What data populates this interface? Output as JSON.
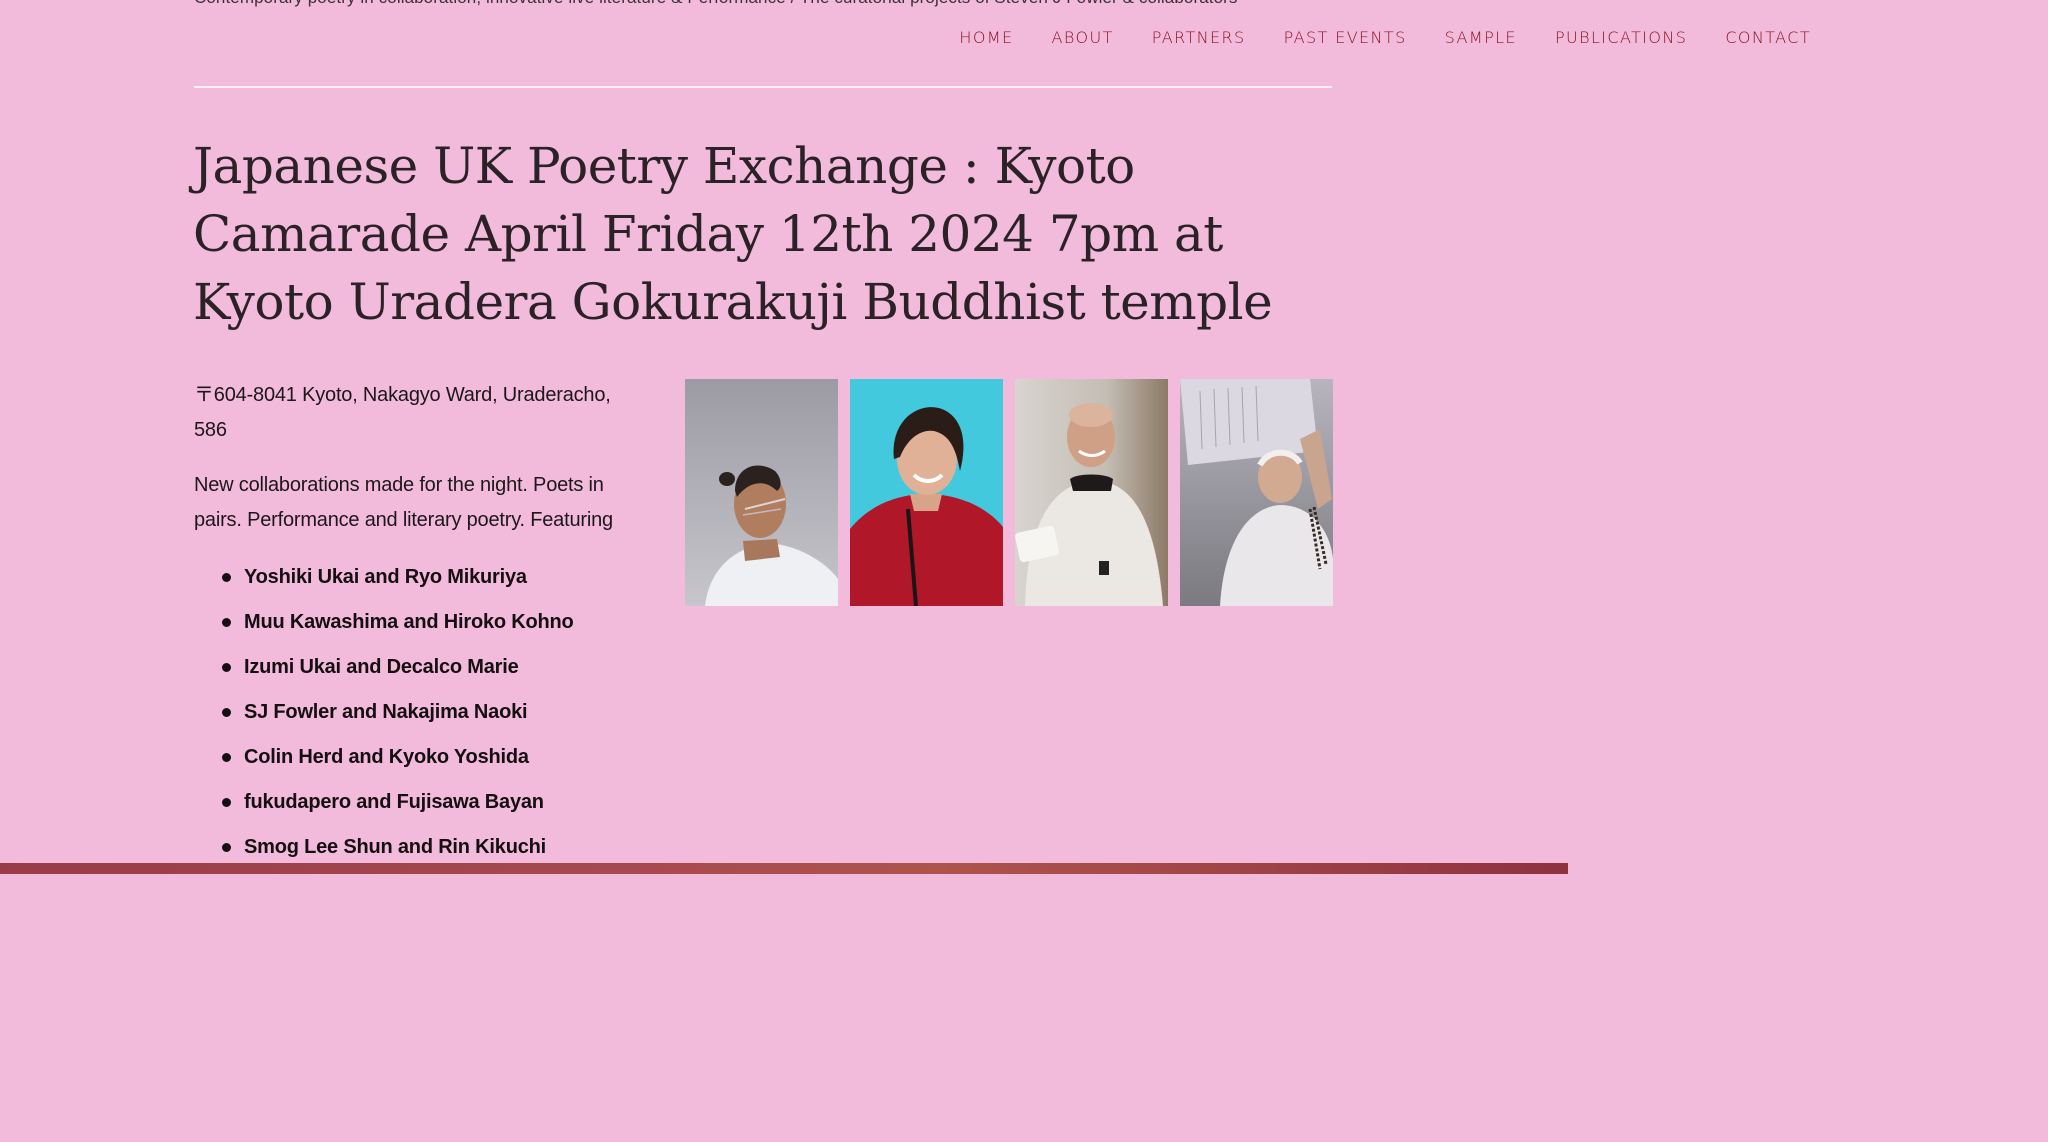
{
  "site": {
    "tagline": "Contemporary poetry in collaboration, innovative live literature & Performance / The curatorial projects of Steven J Fowler & collaborators"
  },
  "nav": {
    "items": [
      {
        "label": "HOME"
      },
      {
        "label": "ABOUT"
      },
      {
        "label": "PARTNERS"
      },
      {
        "label": "PAST EVENTS"
      },
      {
        "label": "SAMPLE"
      },
      {
        "label": "PUBLICATIONS"
      },
      {
        "label": "CONTACT"
      }
    ]
  },
  "post": {
    "title": "Japanese UK Poetry Exchange : Kyoto Camarade April Friday 12th 2024 7pm at Kyoto Uradera Gokurakuji Buddhist temple",
    "address": "〒604-8041 Kyoto, Nakagyo Ward, Uraderacho, 586",
    "intro": "New collaborations made for the night. Poets in pairs. Performance and literary poetry. Featuring",
    "pairs": [
      "Yoshiki Ukai and Ryo Mikuriya",
      "Muu Kawashima and Hiroko Kohno",
      "Izumi Ukai and Decalco Marie",
      "SJ Fowler and Nakajima Naoki",
      "Colin Herd and Kyoko Yoshida",
      "fukudapero and Fujisawa Bayan",
      "Smog Lee Shun and Rin Kikuchi"
    ]
  },
  "colors": {
    "background": "#f3bbdb",
    "nav_text": "#8a1322",
    "divider": "#faf1f6"
  }
}
